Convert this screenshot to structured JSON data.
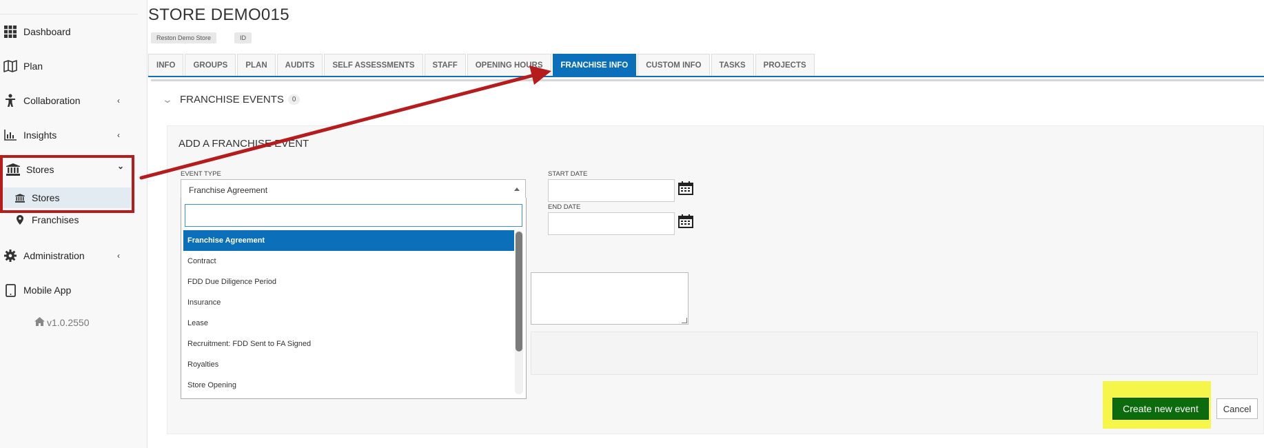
{
  "sidebar": {
    "items": [
      {
        "label": "Dashboard",
        "icon": "grid-icon"
      },
      {
        "label": "Plan",
        "icon": "map-icon"
      },
      {
        "label": "Collaboration",
        "icon": "person-icon",
        "chevron": "‹"
      },
      {
        "label": "Insights",
        "icon": "bar-chart-icon",
        "chevron": "‹"
      },
      {
        "label": "Stores",
        "icon": "bank-icon",
        "chevron": "⌄"
      },
      {
        "label": "Administration",
        "icon": "gear-icon",
        "chevron": "‹"
      },
      {
        "label": "Mobile App",
        "icon": "tablet-icon"
      }
    ],
    "sub_items": [
      {
        "label": "Stores",
        "icon": "bank-icon"
      },
      {
        "label": "Franchises",
        "icon": "pin-icon"
      }
    ],
    "version": "v1.0.2550"
  },
  "header": {
    "title": "STORE DEMO015",
    "chips": [
      "Reston Demo Store",
      "ID"
    ]
  },
  "tabs": [
    {
      "label": "INFO"
    },
    {
      "label": "GROUPS"
    },
    {
      "label": "PLAN"
    },
    {
      "label": "AUDITS"
    },
    {
      "label": "SELF ASSESSMENTS"
    },
    {
      "label": "STAFF"
    },
    {
      "label": "OPENING HOURS"
    },
    {
      "label": "FRANCHISE INFO"
    },
    {
      "label": "CUSTOM INFO"
    },
    {
      "label": "TASKS"
    },
    {
      "label": "PROJECTS"
    }
  ],
  "active_tab": "FRANCHISE INFO",
  "section": {
    "title": "FRANCHISE EVENTS",
    "count": "0"
  },
  "form": {
    "title": "ADD A FRANCHISE EVENT",
    "event_type_label": "EVENT TYPE",
    "event_type_value": "Franchise Agreement",
    "start_date_label": "START DATE",
    "end_date_label": "END DATE",
    "search_value": "",
    "options": [
      "Franchise Agreement",
      "Contract",
      "FDD Due Diligence Period",
      "Insurance",
      "Lease",
      "Recruitment: FDD Sent to FA Signed",
      "Royalties",
      "Store Opening"
    ],
    "selected_option": "Franchise Agreement",
    "create_label": "Create new event",
    "cancel_label": "Cancel"
  },
  "colors": {
    "primary": "#0c6fba",
    "create_button": "#0c6b0c",
    "annotation_red": "#b71c1c",
    "annotation_yellow": "#f5f54a"
  }
}
